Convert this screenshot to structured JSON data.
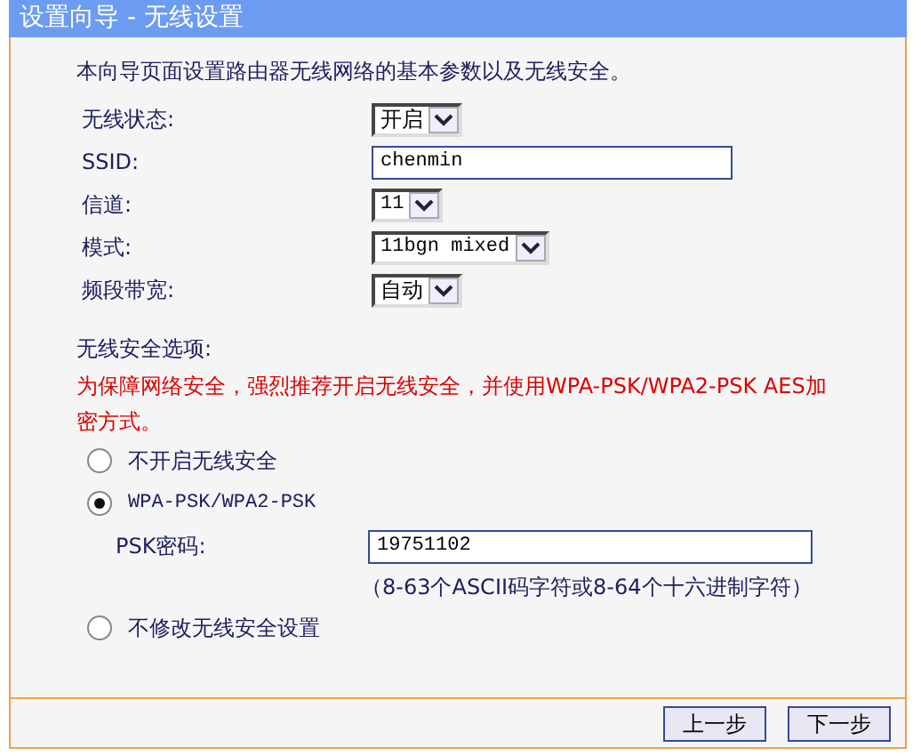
{
  "window": {
    "title": "设置向导 - 无线设置"
  },
  "intro": "本向导页面设置路由器无线网络的基本参数以及无线安全。",
  "fields": [
    {
      "label": "无线状态:",
      "kind": "select",
      "value": "开启"
    },
    {
      "label": "SSID:",
      "kind": "text",
      "value": "chenmin"
    },
    {
      "label": "信道:",
      "kind": "select",
      "value": "11"
    },
    {
      "label": "模式:",
      "kind": "select",
      "value": "11bgn mixed"
    },
    {
      "label": "频段带宽:",
      "kind": "select",
      "value": "自动"
    }
  ],
  "security": {
    "heading": "无线安全选项:",
    "warning": "为保障网络安全，强烈推荐开启无线安全，并使用WPA-PSK/WPA2-PSK AES加密方式。",
    "options": [
      {
        "label": "不开启无线安全",
        "selected": false
      },
      {
        "label": "WPA-PSK/WPA2-PSK",
        "selected": true,
        "password": {
          "label": "PSK密码:",
          "value": "19751102",
          "hint": "（8-63个ASCII码字符或8-64个十六进制字符）"
        }
      },
      {
        "label": "不修改无线安全设置",
        "selected": false
      }
    ]
  },
  "buttons": [
    "上一步",
    "下一步"
  ]
}
